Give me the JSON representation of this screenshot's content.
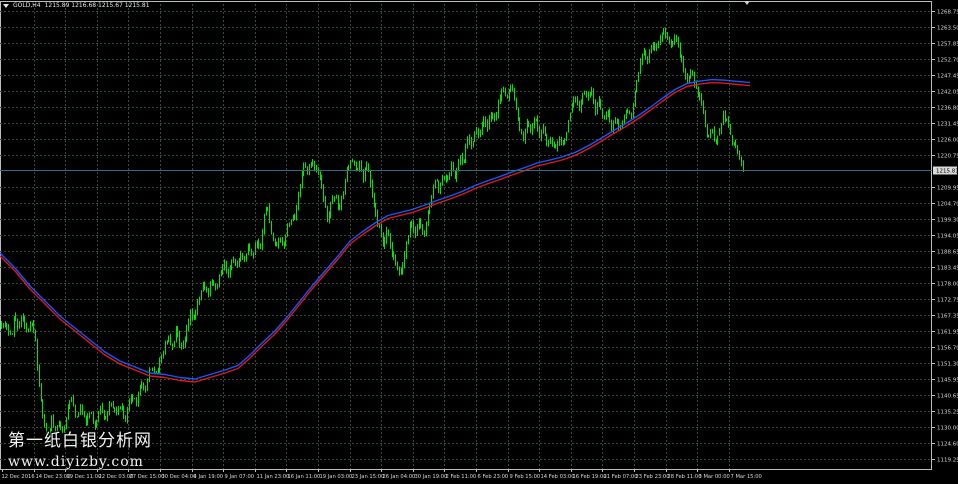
{
  "colors": {
    "background": "#000000",
    "grid": "#3a4a3a",
    "axis_text": "#d9d9d9",
    "bull": "#00e600",
    "ma_fast": "#1a56ff",
    "ma_slow": "#e01919",
    "price_line": "#2f6d8a",
    "price_label_bg": "#d9d9d9",
    "price_label_text": "#000000"
  },
  "header": {
    "symbol": "GOLD,H4",
    "ohlc": "1215.89 1216.68 1215.67 1215.81"
  },
  "current_price_label": "1215.81",
  "watermark": {
    "title": "第一纸白银分析网",
    "url": "www.diyizby.com"
  },
  "chart_data": {
    "type": "candlestick",
    "symbol": "GOLD",
    "timeframe": "H4",
    "ylim": [
      1116.0,
      1271.0
    ],
    "current_price": 1215.81,
    "y_ticks": [
      "1268.75",
      "1263.50",
      "1257.85",
      "1252.70",
      "1247.45",
      "1242.05",
      "1236.80",
      "1231.45",
      "1226.00",
      "1220.75",
      "1215.81",
      "1209.95",
      "1204.70",
      "1199.30",
      "1194.05",
      "1188.65",
      "1183.45",
      "1178.00",
      "1172.75",
      "1167.35",
      "1161.95",
      "1156.70",
      "1151.30",
      "1145.95",
      "1140.65",
      "1135.25",
      "1130.00",
      "1124.60",
      "1119.25"
    ],
    "x_ticks": [
      "12 Dec 2016",
      "14 Dec 23:00",
      "19 Dec 11:00",
      "22 Dec 03:00",
      "27 Dec 15:00",
      "30 Dec 04:00",
      "4 Jan 19:00",
      "9 Jan 07:00",
      "11 Jan 23:00",
      "16 Jan 11:00",
      "19 Jan 03:00",
      "23 Jan 15:00",
      "26 Jan 04:00",
      "30 Jan 19:00",
      "2 Feb 11:00",
      "6 Feb 23:00",
      "9 Feb 15:00",
      "14 Feb 03:00",
      "16 Feb 19:00",
      "21 Feb 07:00",
      "23 Feb 23:00",
      "28 Feb 11:00",
      "3 Mar 00:00",
      "7 Mar 15:00"
    ],
    "price_path": [
      [
        0,
        1165
      ],
      [
        6,
        1163
      ],
      [
        12,
        1161
      ],
      [
        14,
        1168
      ],
      [
        18,
        1163
      ],
      [
        22,
        1167
      ],
      [
        27,
        1161
      ],
      [
        31,
        1166
      ],
      [
        35,
        1160
      ],
      [
        37,
        1150
      ],
      [
        40,
        1140
      ],
      [
        44,
        1130
      ],
      [
        47,
        1124
      ],
      [
        51,
        1133
      ],
      [
        55,
        1128
      ],
      [
        59,
        1133
      ],
      [
        63,
        1127
      ],
      [
        67,
        1136
      ],
      [
        71,
        1140
      ],
      [
        76,
        1132
      ],
      [
        80,
        1137
      ],
      [
        85,
        1131
      ],
      [
        90,
        1135
      ],
      [
        95,
        1130
      ],
      [
        100,
        1137
      ],
      [
        105,
        1133
      ],
      [
        110,
        1138
      ],
      [
        115,
        1135
      ],
      [
        120,
        1137
      ],
      [
        125,
        1131
      ],
      [
        130,
        1141
      ],
      [
        136,
        1138
      ],
      [
        140,
        1145
      ],
      [
        145,
        1142
      ],
      [
        148,
        1148
      ],
      [
        152,
        1150
      ],
      [
        156,
        1148
      ],
      [
        160,
        1152
      ],
      [
        164,
        1157
      ],
      [
        168,
        1160
      ],
      [
        172,
        1156
      ],
      [
        176,
        1163
      ],
      [
        180,
        1155
      ],
      [
        184,
        1158
      ],
      [
        187,
        1163
      ],
      [
        190,
        1168
      ],
      [
        194,
        1166
      ],
      [
        198,
        1172
      ],
      [
        203,
        1178
      ],
      [
        207,
        1174
      ],
      [
        211,
        1179
      ],
      [
        215,
        1176
      ],
      [
        220,
        1181
      ],
      [
        224,
        1185
      ],
      [
        228,
        1180
      ],
      [
        232,
        1186
      ],
      [
        236,
        1184
      ],
      [
        240,
        1188
      ],
      [
        244,
        1185
      ],
      [
        248,
        1190
      ],
      [
        252,
        1186
      ],
      [
        256,
        1192
      ],
      [
        260,
        1188
      ],
      [
        263,
        1200
      ],
      [
        267,
        1204
      ],
      [
        271,
        1195
      ],
      [
        275,
        1190
      ],
      [
        279,
        1193
      ],
      [
        283,
        1190
      ],
      [
        287,
        1197
      ],
      [
        291,
        1199
      ],
      [
        295,
        1201
      ],
      [
        299,
        1209
      ],
      [
        303,
        1218
      ],
      [
        307,
        1215
      ],
      [
        311,
        1219
      ],
      [
        315,
        1216
      ],
      [
        319,
        1214
      ],
      [
        323,
        1207
      ],
      [
        327,
        1199
      ],
      [
        331,
        1205
      ],
      [
        335,
        1208
      ],
      [
        339,
        1202
      ],
      [
        343,
        1209
      ],
      [
        347,
        1216
      ],
      [
        351,
        1220
      ],
      [
        355,
        1215
      ],
      [
        359,
        1218
      ],
      [
        363,
        1213
      ],
      [
        367,
        1218
      ],
      [
        371,
        1209
      ],
      [
        375,
        1201
      ],
      [
        379,
        1196
      ],
      [
        383,
        1190
      ],
      [
        387,
        1196
      ],
      [
        391,
        1188
      ],
      [
        395,
        1185
      ],
      [
        399,
        1180
      ],
      [
        403,
        1185
      ],
      [
        407,
        1193
      ],
      [
        411,
        1199
      ],
      [
        415,
        1194
      ],
      [
        419,
        1199
      ],
      [
        423,
        1193
      ],
      [
        427,
        1200
      ],
      [
        431,
        1207
      ],
      [
        435,
        1213
      ],
      [
        439,
        1209
      ],
      [
        443,
        1215
      ],
      [
        447,
        1211
      ],
      [
        451,
        1218
      ],
      [
        455,
        1212
      ],
      [
        459,
        1221
      ],
      [
        463,
        1217
      ],
      [
        467,
        1227
      ],
      [
        471,
        1223
      ],
      [
        475,
        1230
      ],
      [
        479,
        1227
      ],
      [
        483,
        1232
      ],
      [
        487,
        1230
      ],
      [
        491,
        1235
      ],
      [
        495,
        1233
      ],
      [
        499,
        1240
      ],
      [
        503,
        1243
      ],
      [
        507,
        1240
      ],
      [
        511,
        1244
      ],
      [
        515,
        1238
      ],
      [
        519,
        1229
      ],
      [
        523,
        1226
      ],
      [
        527,
        1232
      ],
      [
        531,
        1228
      ],
      [
        535,
        1234
      ],
      [
        539,
        1226
      ],
      [
        543,
        1230
      ],
      [
        547,
        1224
      ],
      [
        551,
        1226
      ],
      [
        555,
        1222
      ],
      [
        559,
        1227
      ],
      [
        563,
        1224
      ],
      [
        567,
        1230
      ],
      [
        571,
        1236
      ],
      [
        575,
        1240
      ],
      [
        579,
        1236
      ],
      [
        583,
        1242
      ],
      [
        587,
        1240
      ],
      [
        591,
        1243
      ],
      [
        595,
        1235
      ],
      [
        599,
        1239
      ],
      [
        603,
        1232
      ],
      [
        607,
        1236
      ],
      [
        611,
        1229
      ],
      [
        615,
        1233
      ],
      [
        619,
        1229
      ],
      [
        623,
        1233
      ],
      [
        627,
        1236
      ],
      [
        631,
        1234
      ],
      [
        635,
        1242
      ],
      [
        639,
        1250
      ],
      [
        643,
        1256
      ],
      [
        647,
        1252
      ],
      [
        651,
        1258
      ],
      [
        655,
        1256
      ],
      [
        659,
        1259
      ],
      [
        663,
        1262
      ],
      [
        667,
        1260
      ],
      [
        671,
        1257
      ],
      [
        675,
        1261
      ],
      [
        679,
        1255
      ],
      [
        683,
        1250
      ],
      [
        687,
        1245
      ],
      [
        691,
        1249
      ],
      [
        695,
        1244
      ],
      [
        699,
        1240
      ],
      [
        703,
        1235
      ],
      [
        707,
        1226
      ],
      [
        711,
        1230
      ],
      [
        715,
        1224
      ],
      [
        719,
        1229
      ],
      [
        723,
        1234
      ],
      [
        727,
        1232
      ],
      [
        731,
        1226
      ],
      [
        735,
        1223
      ],
      [
        739,
        1220
      ],
      [
        743,
        1215.81
      ]
    ],
    "ma_fast_path": [
      [
        0,
        1188
      ],
      [
        15,
        1183
      ],
      [
        30,
        1177
      ],
      [
        45,
        1172
      ],
      [
        60,
        1167
      ],
      [
        75,
        1163
      ],
      [
        90,
        1159
      ],
      [
        105,
        1155
      ],
      [
        120,
        1152
      ],
      [
        135,
        1150
      ],
      [
        150,
        1148
      ],
      [
        165,
        1147.5
      ],
      [
        180,
        1146.5
      ],
      [
        195,
        1146
      ],
      [
        210,
        1147.5
      ],
      [
        225,
        1149
      ],
      [
        238,
        1150.5
      ],
      [
        250,
        1154
      ],
      [
        262,
        1158
      ],
      [
        275,
        1162
      ],
      [
        288,
        1167
      ],
      [
        300,
        1172
      ],
      [
        312,
        1177
      ],
      [
        325,
        1182
      ],
      [
        338,
        1187
      ],
      [
        350,
        1192
      ],
      [
        362,
        1195
      ],
      [
        375,
        1198
      ],
      [
        388,
        1200.5
      ],
      [
        400,
        1201.5
      ],
      [
        412,
        1202.5
      ],
      [
        425,
        1204
      ],
      [
        437,
        1205.5
      ],
      [
        450,
        1207
      ],
      [
        462,
        1208.5
      ],
      [
        475,
        1210.5
      ],
      [
        487,
        1212
      ],
      [
        500,
        1213.5
      ],
      [
        512,
        1215
      ],
      [
        525,
        1216.5
      ],
      [
        537,
        1218
      ],
      [
        550,
        1219
      ],
      [
        562,
        1220
      ],
      [
        575,
        1221.5
      ],
      [
        587,
        1223.5
      ],
      [
        600,
        1226
      ],
      [
        612,
        1228.5
      ],
      [
        625,
        1231
      ],
      [
        637,
        1233.5
      ],
      [
        650,
        1236.5
      ],
      [
        662,
        1239.5
      ],
      [
        675,
        1242.5
      ],
      [
        687,
        1244.5
      ],
      [
        700,
        1245.3
      ],
      [
        712,
        1245.8
      ],
      [
        725,
        1245.6
      ],
      [
        737,
        1245.2
      ],
      [
        750,
        1244.8
      ]
    ],
    "ma_slow_path": [
      [
        0,
        1187
      ],
      [
        15,
        1182
      ],
      [
        30,
        1176
      ],
      [
        45,
        1171
      ],
      [
        60,
        1166
      ],
      [
        75,
        1162
      ],
      [
        90,
        1158
      ],
      [
        105,
        1154
      ],
      [
        120,
        1151
      ],
      [
        135,
        1149
      ],
      [
        150,
        1147
      ],
      [
        165,
        1146.5
      ],
      [
        180,
        1145.5
      ],
      [
        195,
        1145
      ],
      [
        210,
        1146.5
      ],
      [
        225,
        1148
      ],
      [
        238,
        1149.5
      ],
      [
        250,
        1153
      ],
      [
        262,
        1157
      ],
      [
        275,
        1161
      ],
      [
        288,
        1166
      ],
      [
        300,
        1171
      ],
      [
        312,
        1176
      ],
      [
        325,
        1181
      ],
      [
        338,
        1186
      ],
      [
        350,
        1191
      ],
      [
        362,
        1194
      ],
      [
        375,
        1197
      ],
      [
        388,
        1199.5
      ],
      [
        400,
        1200.5
      ],
      [
        412,
        1201.5
      ],
      [
        425,
        1203
      ],
      [
        437,
        1204.5
      ],
      [
        450,
        1206
      ],
      [
        462,
        1207.5
      ],
      [
        475,
        1209.5
      ],
      [
        487,
        1211
      ],
      [
        500,
        1212.5
      ],
      [
        512,
        1214
      ],
      [
        525,
        1215.5
      ],
      [
        537,
        1217
      ],
      [
        550,
        1218
      ],
      [
        562,
        1219
      ],
      [
        575,
        1220.5
      ],
      [
        587,
        1222.5
      ],
      [
        600,
        1225
      ],
      [
        612,
        1227.5
      ],
      [
        625,
        1230
      ],
      [
        637,
        1232.5
      ],
      [
        650,
        1235.5
      ],
      [
        662,
        1238.5
      ],
      [
        675,
        1241.5
      ],
      [
        687,
        1243.5
      ],
      [
        700,
        1244.3
      ],
      [
        712,
        1244.8
      ],
      [
        725,
        1244.6
      ],
      [
        737,
        1244.2
      ],
      [
        750,
        1243.8
      ]
    ]
  }
}
